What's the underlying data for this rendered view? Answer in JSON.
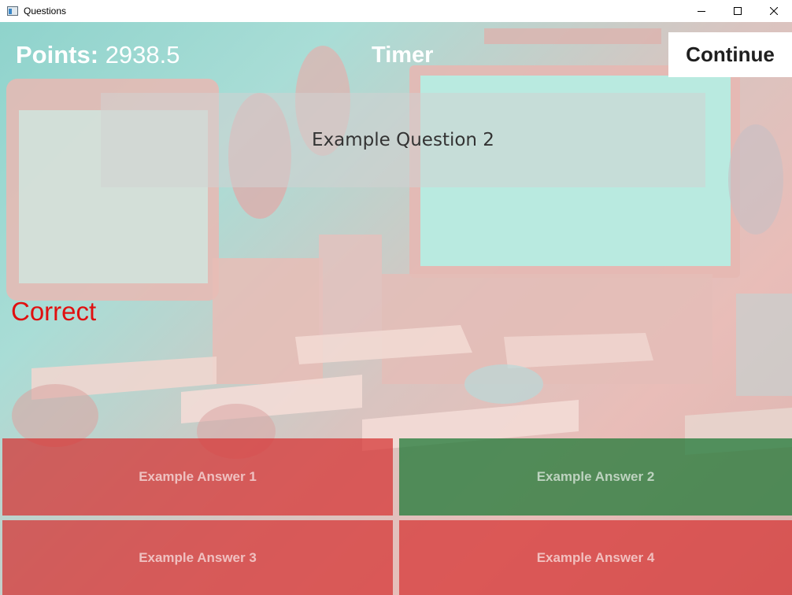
{
  "window": {
    "title": "Questions",
    "icon": "app-window-icon",
    "controls": [
      "minimize-icon",
      "maximize-icon",
      "close-icon"
    ]
  },
  "hud": {
    "points_label": "Points:",
    "points_value": "2938.5",
    "timer_label": "Timer",
    "continue_label": "Continue"
  },
  "question": {
    "text": "Example Question 2"
  },
  "feedback": {
    "text": "Correct",
    "color": "#e01010"
  },
  "answers": [
    {
      "label": "Example Answer 1",
      "state": "incorrect",
      "color": "#d63030"
    },
    {
      "label": "Example Answer 2",
      "state": "correct",
      "color": "#227a38"
    },
    {
      "label": "Example Answer 3",
      "state": "incorrect",
      "color": "#d63030"
    },
    {
      "label": "Example Answer 4",
      "state": "incorrect",
      "color": "#d63030"
    }
  ]
}
